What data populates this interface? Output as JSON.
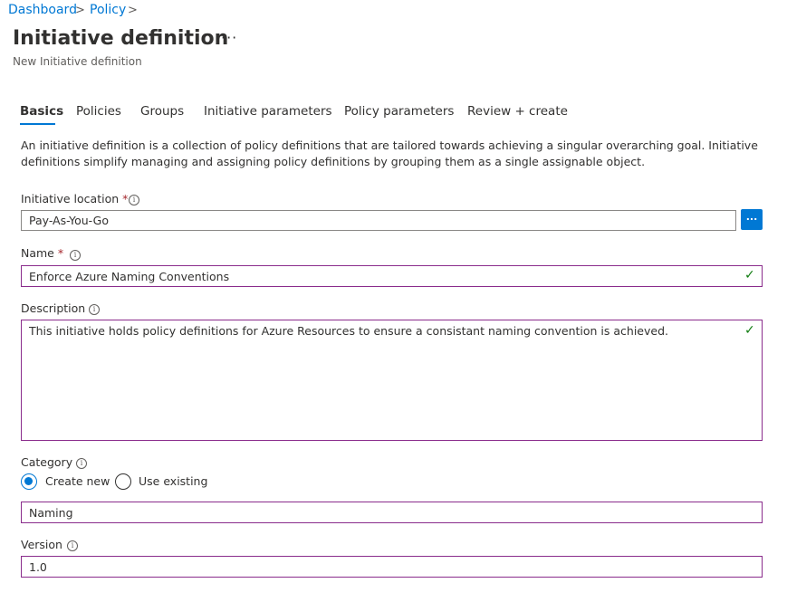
{
  "breadcrumb": {
    "items": [
      "Dashboard",
      "Policy"
    ],
    "separator": ">"
  },
  "header": {
    "title": "Initiative definition",
    "more_label": "···",
    "subtitle": "New Initiative definition"
  },
  "tabs": [
    {
      "label": "Basics",
      "active": true
    },
    {
      "label": "Policies"
    },
    {
      "label": "Groups"
    },
    {
      "label": "Initiative parameters"
    },
    {
      "label": "Policy parameters"
    },
    {
      "label": "Review + create"
    }
  ],
  "intro_text": "An initiative definition is a collection of policy definitions that are tailored towards achieving a singular overarching goal. Initiative definitions simplify managing and assigning policy definitions by grouping them as a single assignable object.",
  "form": {
    "location": {
      "label": "Initiative location",
      "required_mark": "*",
      "value": "Pay-As-You-Go",
      "browse_label": "..."
    },
    "name": {
      "label": "Name",
      "required_mark": "*",
      "value": "Enforce Azure Naming Conventions"
    },
    "description": {
      "label": "Description",
      "value": "This initiative holds policy definitions for Azure Resources to ensure a consistant naming convention is achieved."
    },
    "category": {
      "label": "Category",
      "options": [
        {
          "label": "Create new",
          "selected": true
        },
        {
          "label": "Use existing",
          "selected": false
        }
      ],
      "value": "Naming"
    },
    "version": {
      "label": "Version",
      "value": "1.0"
    }
  },
  "icons": {
    "info": "info-icon",
    "valid": "checkmark-icon",
    "chevron": "chevron-right-icon"
  },
  "colors": {
    "accent": "#0078d4",
    "focus_border": "#8a2c8c",
    "valid": "#107c10",
    "required": "#a4262c"
  }
}
